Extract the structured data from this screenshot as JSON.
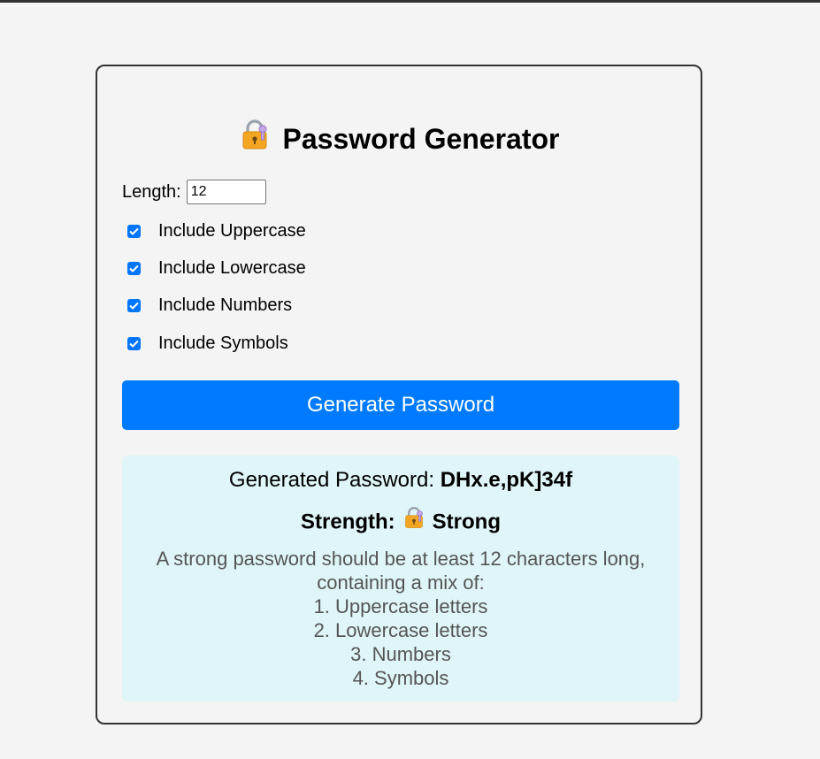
{
  "app": {
    "title": "Password Generator",
    "title_icon": "lock-with-key-icon"
  },
  "form": {
    "length_label": "Length:",
    "length_value": "12",
    "options": [
      {
        "label": "Include Uppercase",
        "checked": true
      },
      {
        "label": "Include Lowercase",
        "checked": true
      },
      {
        "label": "Include Numbers",
        "checked": true
      },
      {
        "label": "Include Symbols",
        "checked": true
      }
    ],
    "generate_label": "Generate Password"
  },
  "result": {
    "password_label": "Generated Password:",
    "password_value": "DHx.e,pK]34f",
    "strength_label": "Strength:",
    "strength_value": "Strong",
    "tips": [
      "A strong password should be at least 12 characters long,",
      "containing a mix of:",
      "1. Uppercase letters",
      "2. Lowercase letters",
      "3. Numbers",
      "4. Symbols"
    ]
  },
  "colors": {
    "accent": "#007bff",
    "checkbox": "#0075ff",
    "result_bg": "#dff5f7",
    "page_bg": "#f4f4f4"
  }
}
